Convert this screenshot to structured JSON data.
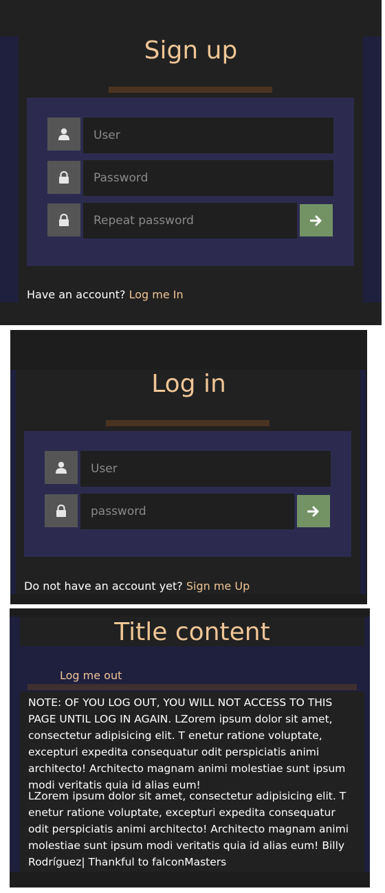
{
  "signup": {
    "title": "Sign up",
    "user_placeholder": "User",
    "password_placeholder": "Password",
    "repeat_placeholder": "Repeat password",
    "footer_text": "Have an account?",
    "footer_link": "Log me In"
  },
  "login": {
    "title": "Log in",
    "user_placeholder": "User",
    "password_placeholder": "password",
    "footer_text": "Do not have an account yet?",
    "footer_link": "Sign me Up"
  },
  "content": {
    "title": "Title content",
    "logout_link": "Log me out",
    "paragraph1": "NOTE: OF YOU LOG OUT, YOU WILL NOT ACCESS TO THIS PAGE UNTIL LOG IN AGAIN. LZorem ipsum dolor sit amet, consectetur adipisicing elit. T enetur ratione voluptate, excepturi expedita consequatur odit perspiciatis animi architecto! Architecto magnam animi molestiae sunt ipsum modi veritatis quia id alias eum!",
    "paragraph2": "LZorem ipsum dolor sit amet, consectetur adipisicing elit. T enetur ratione voluptate, excepturi expedita consequatur odit perspiciatis animi architecto! Architecto magnam animi molestiae sunt ipsum modi veritatis quia id alias eum! Billy Rodríguez| Thankful to falconMasters"
  },
  "icons": {
    "user": "user-icon",
    "lock": "lock-icon",
    "submit": "arrow-right-icon"
  },
  "colors": {
    "accent": "#efc596",
    "submit": "#739365",
    "panel": "#212121",
    "form": "#2c2b4f",
    "navy": "#1f1f3e"
  }
}
